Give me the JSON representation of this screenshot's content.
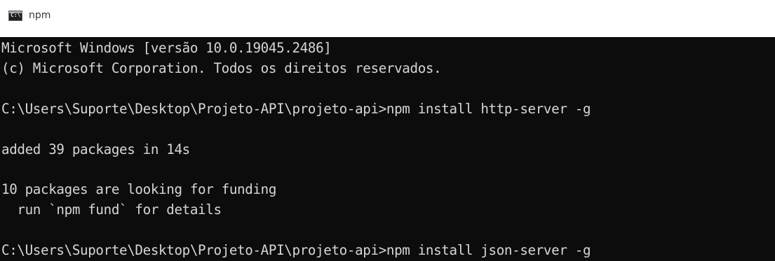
{
  "window": {
    "title": "npm",
    "icon": "console-icon"
  },
  "console": {
    "background": "#0c0c0c",
    "foreground": "#d6d6d6",
    "lines": [
      "Microsoft Windows [versão 10.0.19045.2486]",
      "(c) Microsoft Corporation. Todos os direitos reservados.",
      "",
      "C:\\Users\\Suporte\\Desktop\\Projeto-API\\projeto-api>npm install http-server -g",
      "",
      "added 39 packages in 14s",
      "",
      "10 packages are looking for funding",
      "  run `npm fund` for details",
      "",
      "C:\\Users\\Suporte\\Desktop\\Projeto-API\\projeto-api>npm install json-server -g"
    ]
  }
}
